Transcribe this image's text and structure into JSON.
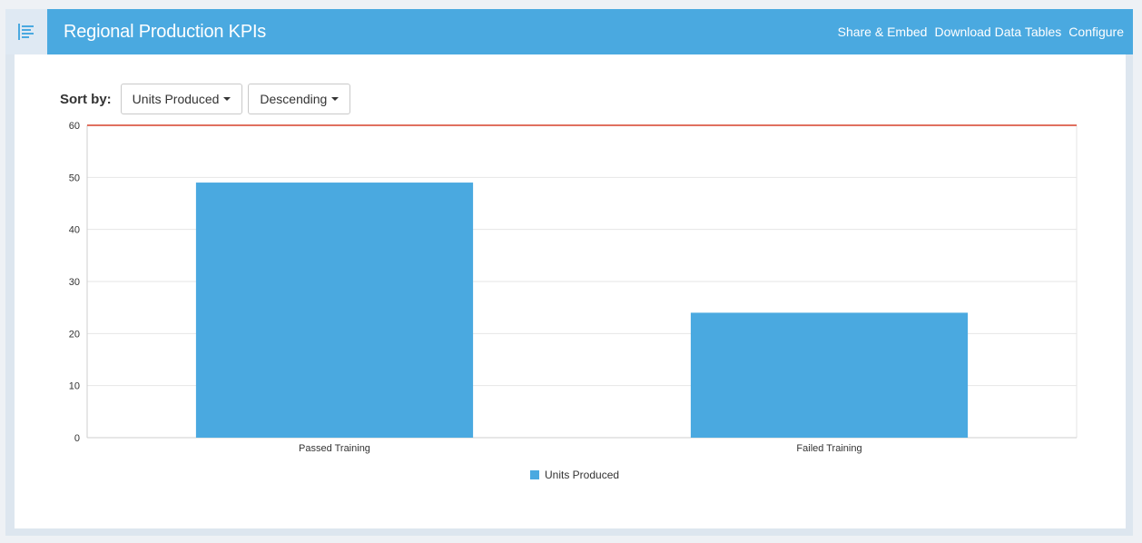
{
  "header": {
    "title": "Regional Production KPIs",
    "links": [
      {
        "label": "Share & Embed"
      },
      {
        "label": "Download Data Tables"
      },
      {
        "label": "Configure"
      }
    ],
    "menu_icon": "list-menu-icon"
  },
  "sort": {
    "label": "Sort by:",
    "field_value": "Units Produced",
    "order_value": "Descending"
  },
  "colors": {
    "header": "#4aa9e0",
    "bar": "#4aa9e0",
    "reference_line": "#e0705f",
    "grid": "#e6e6e6"
  },
  "chart_data": {
    "type": "bar",
    "categories": [
      "Passed Training",
      "Failed Training"
    ],
    "series": [
      {
        "name": "Units Produced",
        "values": [
          49,
          24
        ]
      }
    ],
    "yticks": [
      0,
      10,
      20,
      30,
      40,
      50,
      60
    ],
    "ylim": [
      0,
      60
    ],
    "reference_line": 60,
    "grid": true,
    "legend": "bottom-center"
  }
}
